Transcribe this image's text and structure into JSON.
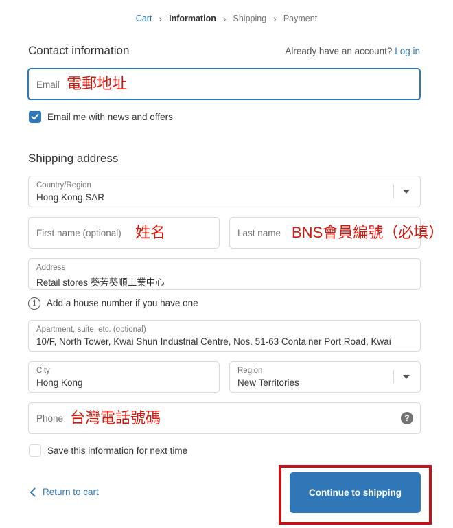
{
  "breadcrumb": {
    "items": [
      "Cart",
      "Information",
      "Shipping",
      "Payment"
    ]
  },
  "contact": {
    "title": "Contact information",
    "account_prompt": "Already have an account?",
    "login_link": "Log in",
    "email_label": "Email",
    "email_annotation": "電郵地址",
    "newsletter_label": "Email me with news and offers",
    "newsletter_checked": true
  },
  "shipping": {
    "title": "Shipping address",
    "country_label": "Country/Region",
    "country_value": "Hong Kong SAR",
    "first_name_placeholder": "First name (optional)",
    "first_name_annotation": "姓名",
    "last_name_placeholder": "Last name",
    "last_name_annotation": "BNS會員編號（必填）",
    "address_label": "Address",
    "address_value": "Retail stores 葵芳葵順工業中心",
    "house_number_hint": "Add a house number if you have one",
    "apartment_label": "Apartment, suite, etc. (optional)",
    "apartment_value": "10/F, North Tower, Kwai Shun Industrial Centre, Nos. 51-63 Container Port Road, Kwai",
    "city_label": "City",
    "city_value": "Hong Kong",
    "region_label": "Region",
    "region_value": "New Territories",
    "phone_placeholder": "Phone",
    "phone_annotation": "台灣電話號碼",
    "phone_help_icon": "?",
    "save_info_label": "Save this information for next time",
    "save_info_checked": false
  },
  "footer": {
    "return_label": "Return to cart",
    "continue_label": "Continue to shipping"
  },
  "colors": {
    "accent": "#2f77b6",
    "annotation": "#d8140a",
    "highlight_border": "#c0141a"
  },
  "icons": [
    "chevron-right-icon",
    "check-icon",
    "caret-down-icon",
    "info-icon",
    "help-icon",
    "chevron-left-icon"
  ]
}
